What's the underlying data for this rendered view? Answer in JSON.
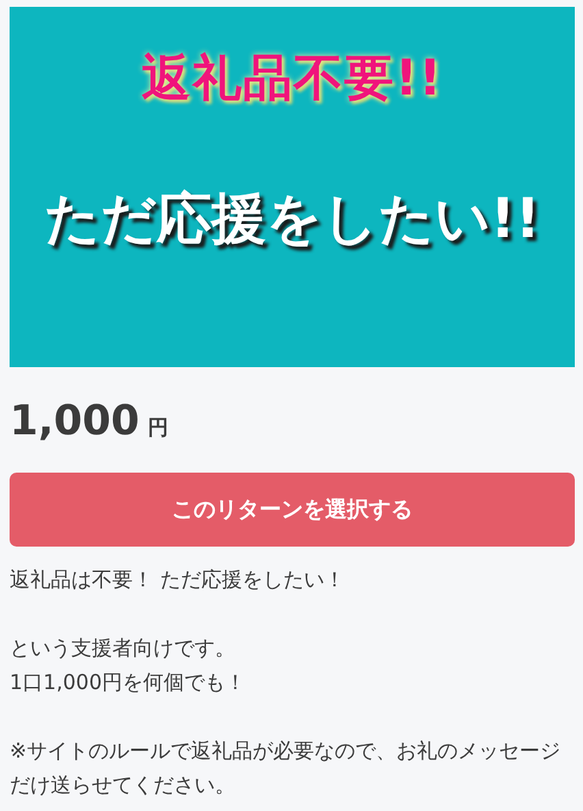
{
  "banner": {
    "headline": "返礼品不要!!",
    "tagline": "ただ応援をしたい!!"
  },
  "price": {
    "amount": "1,000",
    "unit": "円"
  },
  "select_button": "このリターンを選択する",
  "description": [
    "返礼品は不要！ ただ応援をしたい！",
    "という支援者向けです。\n1口1,000円を何個でも！",
    "※サイトのルールで返礼品が必要なので、お礼のメッセージだけ送らせてください。"
  ]
}
